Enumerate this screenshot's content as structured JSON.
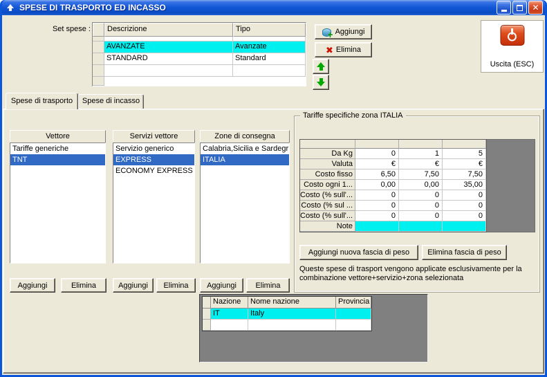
{
  "window": {
    "title": "SPESE DI TRASPORTO ED INCASSO"
  },
  "colors": {
    "titlebar_blue": "#0C56DA",
    "selection_cyan": "#00F0F0",
    "selection_blue": "#316AC5",
    "window_face": "#ECE9D8",
    "panel_gray": "#808080",
    "exit_red": "#D23A10",
    "arrow_green": "#00A800"
  },
  "icons": {
    "app": "up-arrow",
    "minimize": "minimize-bar",
    "maximize": "maximize-square",
    "close": "✕",
    "add_plus": "+",
    "delete_x": "✖",
    "power": "power-symbol"
  },
  "set_spese": {
    "label": "Set spese :",
    "columns": [
      "Descrizione",
      "Tipo"
    ],
    "rows": [
      {
        "descrizione": "AVANZATE",
        "tipo": "Avanzate"
      },
      {
        "descrizione": "STANDARD",
        "tipo": "Standard"
      },
      {
        "descrizione": "",
        "tipo": ""
      }
    ],
    "add_button": "Aggiungi",
    "delete_button": "Elimina"
  },
  "exit": {
    "label": "Uscita (ESC)"
  },
  "tabs": {
    "transport": "Spese di trasporto",
    "collection": "Spese di incasso"
  },
  "vettore": {
    "header": "Vettore",
    "items": [
      "Tariffe generiche",
      "TNT"
    ],
    "add_button": "Aggiungi",
    "delete_button": "Elimina"
  },
  "servizi": {
    "header": "Servizi vettore",
    "items": [
      "Servizio generico",
      "EXPRESS",
      "ECONOMY EXPRESS"
    ],
    "add_button": "Aggiungi",
    "delete_button": "Elimina"
  },
  "zone": {
    "header": "Zone di consegna",
    "items": [
      "Calabria,Sicilia e Sardegr",
      "ITALIA"
    ],
    "add_button": "Aggiungi",
    "delete_button": "Elimina"
  },
  "tariffe": {
    "group_title": "Tariffe specifiche zona ITALIA",
    "rows": [
      {
        "label": "Da Kg",
        "v1": "0",
        "v2": "1",
        "v3": "5"
      },
      {
        "label": "Valuta",
        "v1": "€",
        "v2": "€",
        "v3": "€"
      },
      {
        "label": "Costo fisso",
        "v1": "6,50",
        "v2": "7,50",
        "v3": "7,50"
      },
      {
        "label": "Costo ogni 1...",
        "v1": "0,00",
        "v2": "0,00",
        "v3": "35,00"
      },
      {
        "label": "Costo (% sull'...",
        "v1": "0",
        "v2": "0",
        "v3": "0"
      },
      {
        "label": "Costo (% sul ...",
        "v1": "0",
        "v2": "0",
        "v3": "0"
      },
      {
        "label": "Costo (% sull'...",
        "v1": "0",
        "v2": "0",
        "v3": "0"
      },
      {
        "label": "Note",
        "v1": "",
        "v2": "",
        "v3": ""
      }
    ],
    "add_button": "Aggiungi nuova fascia di peso",
    "delete_button": "Elimina fascia di peso",
    "note_line1": "Queste spese di trasport vengono applicate esclusivamente per la",
    "note_line2": "combinazione vettore+servizio+zona selezionata"
  },
  "nazioni": {
    "columns": [
      "Nazione",
      "Nome nazione",
      "Provincia"
    ],
    "rows": [
      {
        "nazione": "IT",
        "nome": "Italy",
        "provincia": ""
      },
      {
        "nazione": "",
        "nome": "",
        "provincia": ""
      }
    ]
  }
}
